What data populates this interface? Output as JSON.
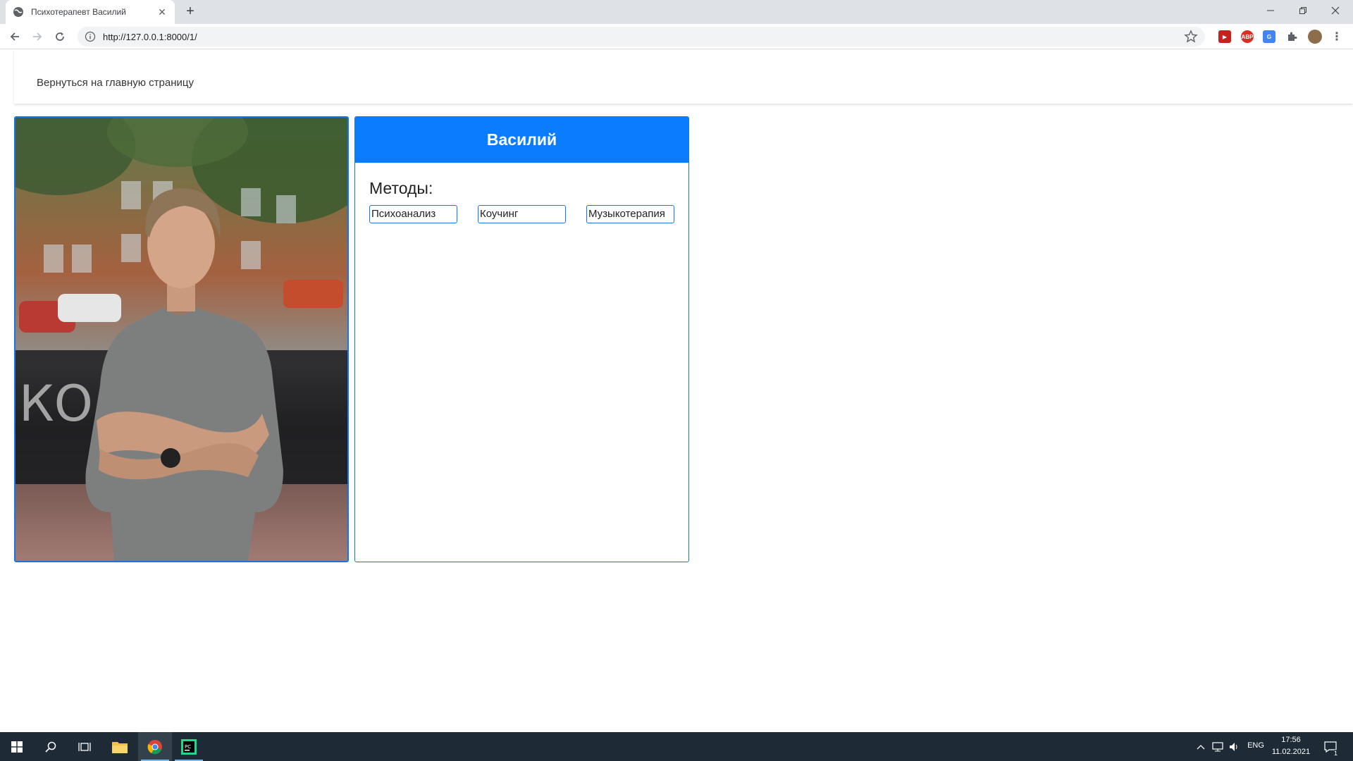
{
  "browser": {
    "tab_title": "Психотерапевт Василий",
    "url": "http://127.0.0.1:8000/1/"
  },
  "nav": {
    "back_link": "Вернуться на главную страницу"
  },
  "profile": {
    "name": "Василий",
    "methods_label": "Методы:",
    "methods": [
      "Психоанализ",
      "Коучинг",
      "Музыкотерапия"
    ],
    "accent_color": "#0a7cff"
  },
  "taskbar": {
    "language": "ENG",
    "time": "17:56",
    "date": "11.02.2021",
    "notification_count": "1"
  }
}
